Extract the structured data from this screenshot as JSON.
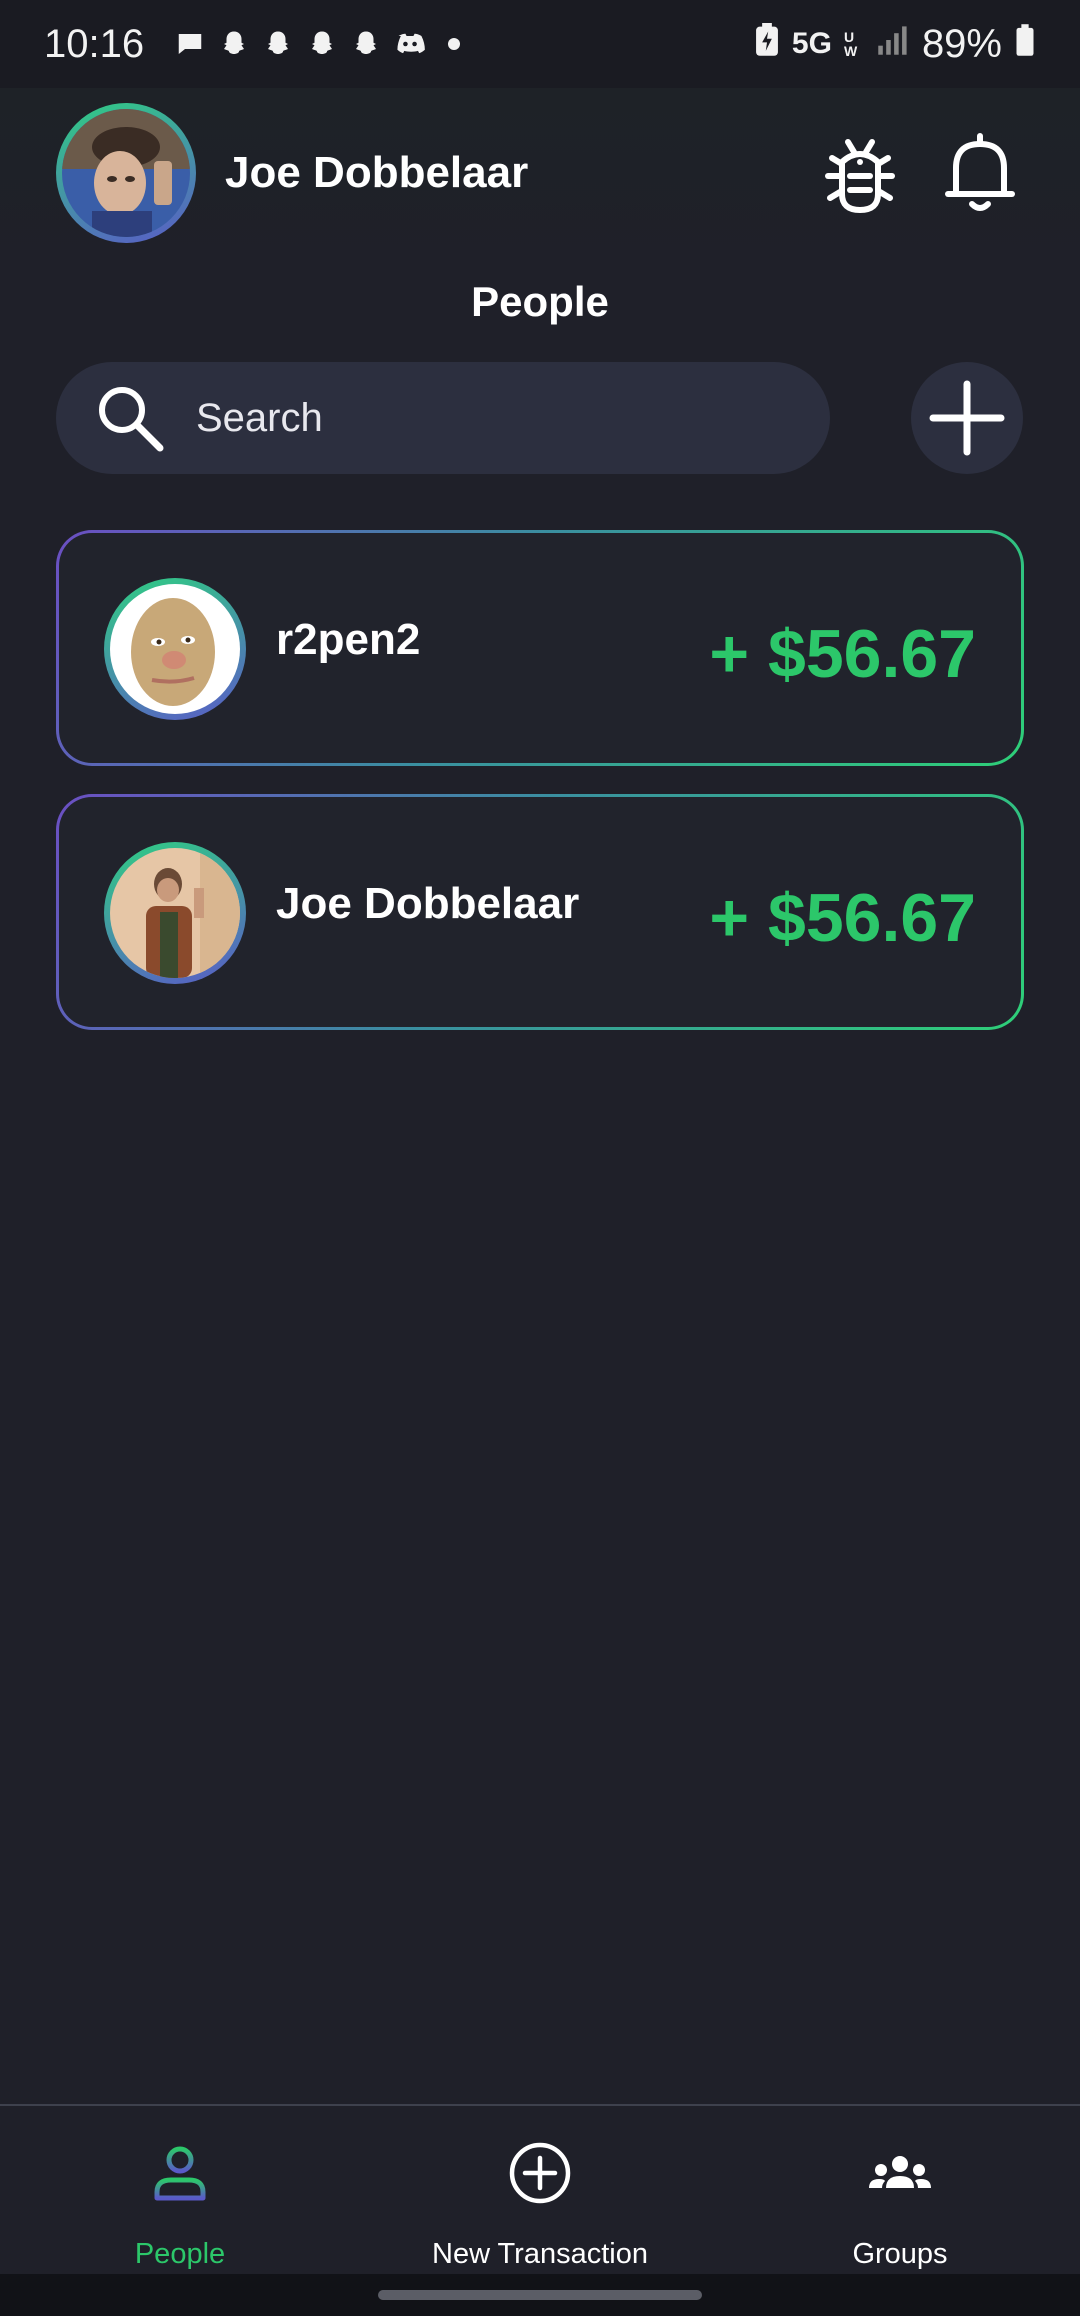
{
  "status_bar": {
    "time": "10:16",
    "network": "5G",
    "network_sub": "UW",
    "battery": "89%",
    "notification_icons": [
      "message-icon",
      "snapchat-icon",
      "snapchat-icon",
      "snapchat-icon",
      "snapchat-icon",
      "discord-icon",
      "dot-icon"
    ]
  },
  "header": {
    "user_name": "Joe Dobbelaar",
    "bug_icon": "bug-icon",
    "bell_icon": "bell-icon"
  },
  "page": {
    "title": "People"
  },
  "search": {
    "placeholder": "Search",
    "value": ""
  },
  "people": [
    {
      "name": "r2pen2",
      "amount": "+ $56.67"
    },
    {
      "name": "Joe Dobbelaar",
      "amount": "+ $56.67"
    }
  ],
  "bottom_nav": {
    "items": [
      {
        "label": "People",
        "icon": "person-icon",
        "active": true
      },
      {
        "label": "New Transaction",
        "icon": "plus-circle-icon",
        "active": false
      },
      {
        "label": "Groups",
        "icon": "groups-icon",
        "active": false
      }
    ]
  },
  "colors": {
    "background": "#1f2029",
    "accent_green": "#2cc76a",
    "accent_purple": "#6b4fc3",
    "surface": "#2c2f3f"
  }
}
